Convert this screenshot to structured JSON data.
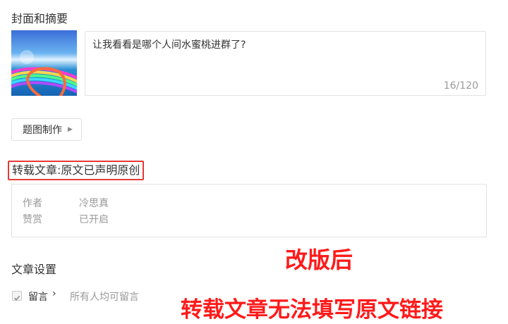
{
  "cover_section": {
    "title": "封面和摘要"
  },
  "summary": {
    "text": "让我看看是哪个人间水蜜桃进群了?",
    "count": "16/120"
  },
  "cover_button": {
    "label": "题图制作"
  },
  "repost": {
    "label": "转载文章:原文已声明原创",
    "rows": [
      {
        "key": "作者",
        "value": "冷思真"
      },
      {
        "key": "赞赏",
        "value": "已开启"
      }
    ]
  },
  "settings": {
    "title": "文章设置",
    "comment_label": "留言",
    "comment_value": "所有人均可留言"
  },
  "annotations": {
    "line1": "改版后",
    "line2": "转载文章无法填写原文链接",
    "color": "#ff1a1a"
  },
  "icons": [
    "cover-image",
    "chevron-right-icon",
    "check-icon"
  ]
}
